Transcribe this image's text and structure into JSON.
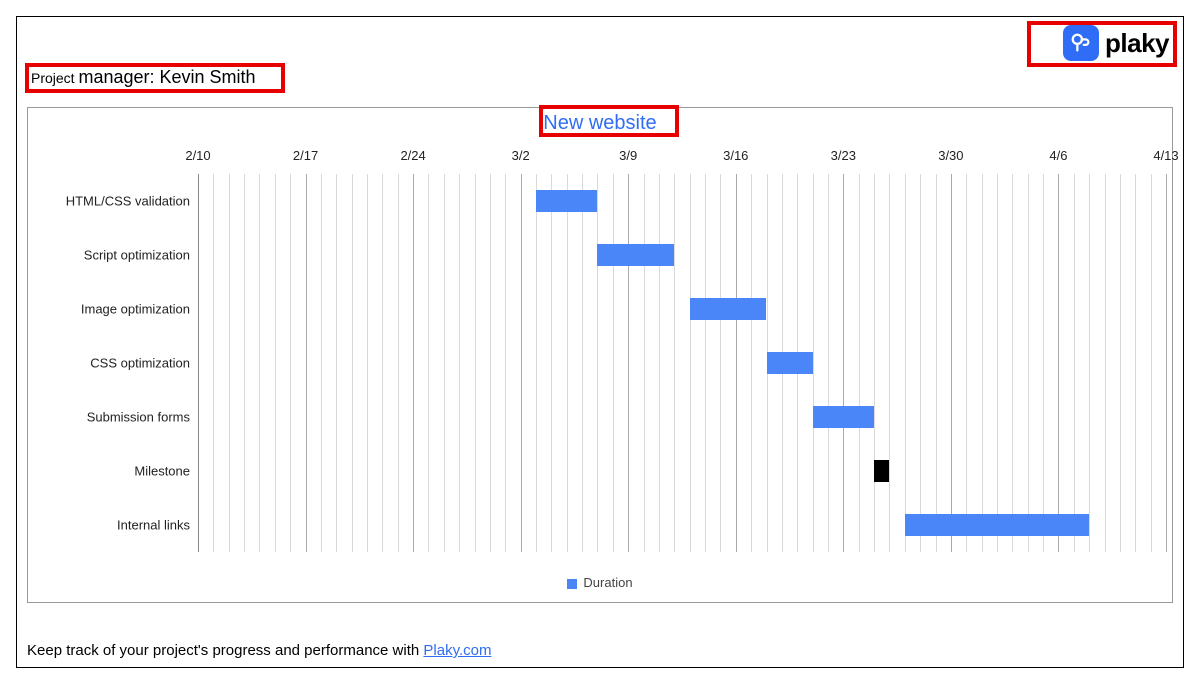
{
  "brand": {
    "name": "plaky"
  },
  "pm": {
    "prefix": "Project ",
    "rest": "manager: Kevin Smith"
  },
  "footer": {
    "text": "Keep track of your project's progress and performance with ",
    "link_text": "Plaky.com"
  },
  "chart_data": {
    "type": "bar",
    "title": "New website",
    "xlabel": "",
    "ylabel": "",
    "legend": "Duration",
    "x_ticks": [
      "2/10",
      "2/17",
      "2/24",
      "3/2",
      "3/9",
      "3/16",
      "3/23",
      "3/30",
      "4/6",
      "4/13"
    ],
    "x_range_days": [
      0,
      63
    ],
    "categories": [
      "HTML/CSS validation",
      "Script optimization",
      "Image optimization",
      "CSS optimization",
      "Submission forms",
      "Milestone",
      "Internal links"
    ],
    "series": [
      {
        "name": "Duration",
        "color": "#4a86f7",
        "bars": [
          {
            "start": "3/3",
            "duration": 4,
            "start_day": 22,
            "milestone": false
          },
          {
            "start": "3/7",
            "duration": 5,
            "start_day": 26,
            "milestone": false
          },
          {
            "start": "3/13",
            "duration": 5,
            "start_day": 32,
            "milestone": false
          },
          {
            "start": "3/18",
            "duration": 3,
            "start_day": 37,
            "milestone": false
          },
          {
            "start": "3/21",
            "duration": 4,
            "start_day": 40,
            "milestone": false
          },
          {
            "start": "3/25",
            "duration": 1,
            "start_day": 44,
            "milestone": true
          },
          {
            "start": "3/27",
            "duration": 12,
            "start_day": 46,
            "milestone": false
          }
        ]
      }
    ]
  }
}
